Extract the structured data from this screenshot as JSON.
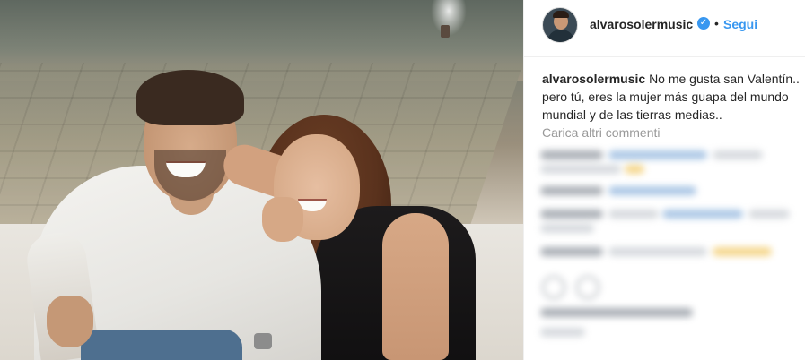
{
  "post": {
    "username": "alvarosolermusic",
    "follow_label": "Segui",
    "separator": "•",
    "caption_user": "alvarosolermusic",
    "caption_text": "No me gusta san Valentín.. pero tú, eres la mujer más guapa del mundo mundial y de las tierras medias..",
    "load_more_label": "Carica altri commenti"
  },
  "icons": {
    "verified": "verified-badge-icon",
    "verified_glyph": "✓"
  },
  "colors": {
    "link_blue": "#3897f0",
    "text_dark": "#262626",
    "muted_gray": "#999999"
  }
}
